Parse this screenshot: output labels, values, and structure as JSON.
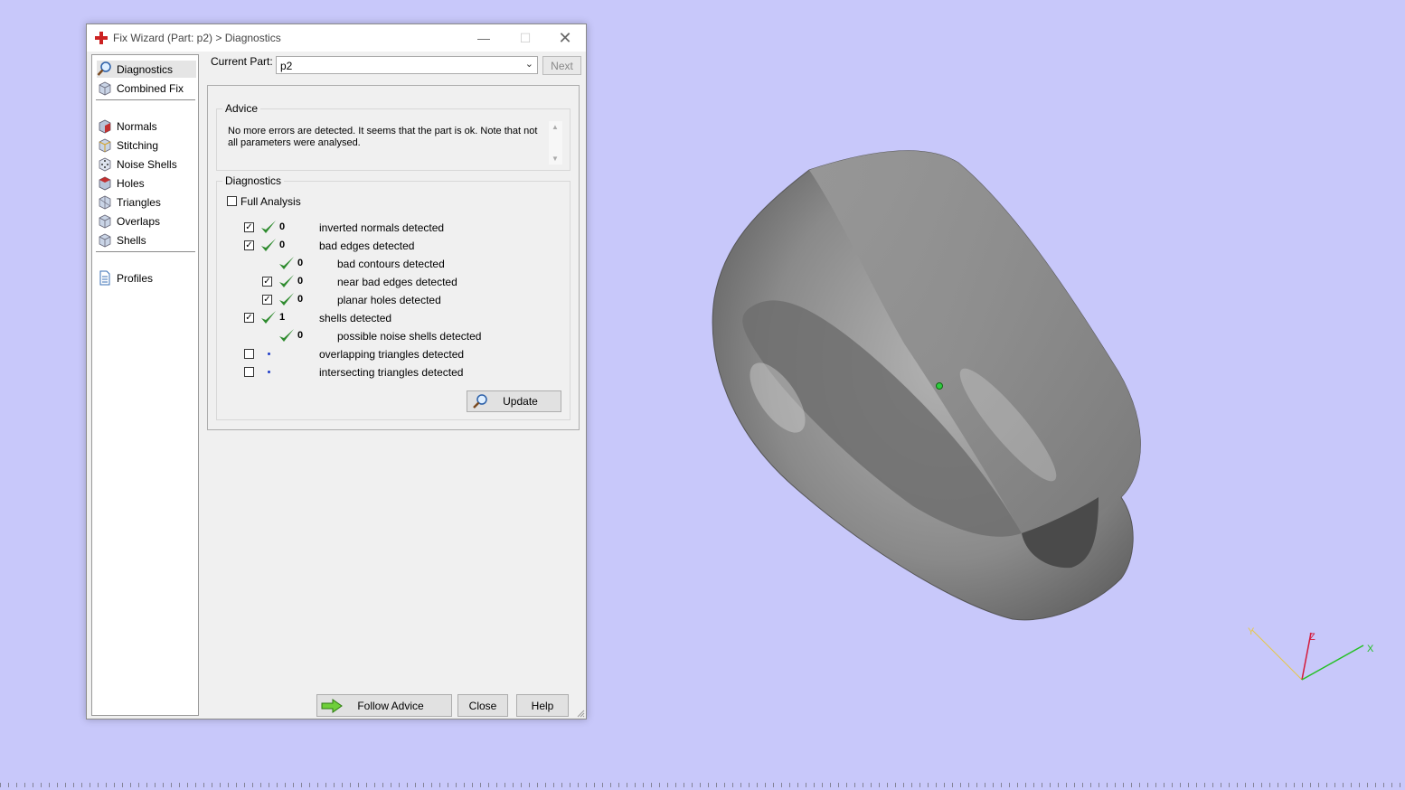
{
  "window": {
    "title": "Fix Wizard (Part: p2) > Diagnostics"
  },
  "sidebar": {
    "items": [
      {
        "label": "Diagnostics",
        "icon": "magnifier-icon"
      },
      {
        "label": "Combined Fix",
        "icon": "cube-icon"
      },
      {
        "label": "Normals",
        "icon": "cube-red-icon"
      },
      {
        "label": "Stitching",
        "icon": "cube-icon"
      },
      {
        "label": "Noise Shells",
        "icon": "dice-icon"
      },
      {
        "label": "Holes",
        "icon": "cube-red-icon"
      },
      {
        "label": "Triangles",
        "icon": "cube-icon"
      },
      {
        "label": "Overlaps",
        "icon": "cube-icon"
      },
      {
        "label": "Shells",
        "icon": "cube-icon"
      },
      {
        "label": "Profiles",
        "icon": "document-icon"
      }
    ]
  },
  "current_part": {
    "label": "Current Part:",
    "value": "p2",
    "next_label": "Next"
  },
  "advice": {
    "title": "Advice",
    "line1": "No more errors are detected. It seems that the part is ok. Note that not",
    "line2": "all parameters were analysed."
  },
  "diagnostics": {
    "title": "Diagnostics",
    "full_analysis": "Full Analysis",
    "rows": [
      {
        "count": "0",
        "label": "inverted normals detected"
      },
      {
        "count": "0",
        "label": "bad edges detected"
      },
      {
        "count": "0",
        "label": "bad contours detected"
      },
      {
        "count": "0",
        "label": "near bad edges detected"
      },
      {
        "count": "0",
        "label": "planar holes detected"
      },
      {
        "count": "1",
        "label": "shells detected"
      },
      {
        "count": "0",
        "label": "possible noise shells detected"
      },
      {
        "count": "",
        "label": "overlapping triangles detected"
      },
      {
        "count": "",
        "label": "intersecting triangles detected"
      }
    ],
    "update_label": "Update"
  },
  "footer": {
    "follow_advice": "Follow Advice",
    "close": "Close",
    "help": "Help"
  },
  "axes": {
    "x": "X",
    "y": "Y",
    "z": "Z"
  },
  "colors": {
    "viewport": "#c8c8fa",
    "check_green": "#2e8b2e",
    "accent_red": "#cc2222"
  }
}
